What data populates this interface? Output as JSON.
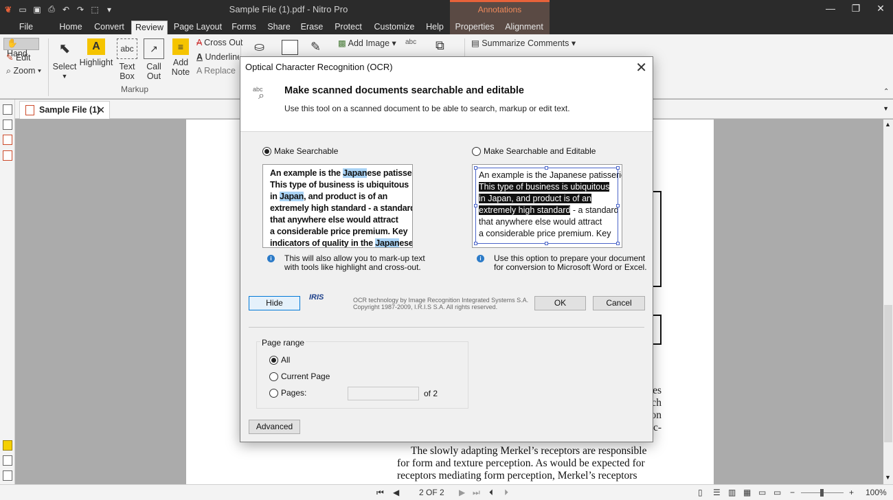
{
  "window": {
    "title": "Sample File (1).pdf - Nitro Pro",
    "context_tab": "Annotations",
    "minimize": "—",
    "restore": "❐",
    "close": "✕"
  },
  "quick_access": [
    "nitro-logo-icon",
    "open-icon",
    "save-icon",
    "print-icon",
    "undo-icon",
    "redo-icon",
    "cursor-icon",
    "customize-icon"
  ],
  "menu": {
    "tabs": [
      "File",
      "Home",
      "Convert",
      "Review",
      "Page Layout",
      "Forms",
      "Share",
      "Erase",
      "Protect",
      "Customize",
      "Help",
      "Properties",
      "Alignment"
    ],
    "active": "Review"
  },
  "ribbon": {
    "hand": "Hand",
    "edit": "Edit",
    "zoom": "Zoom",
    "select": "Select",
    "highlight": "Highlight",
    "text_box_1": "Text",
    "text_box_2": "Box",
    "call_out_1": "Call",
    "call_out_2": "Out",
    "add_note_1": "Add",
    "add_note_2": "Note",
    "cross_out": "Cross Out",
    "underline": "Underline",
    "replace": "Replace",
    "group_label": "Markup",
    "add_image": "Add Image",
    "summarize_comments": "Summarize Comments"
  },
  "document": {
    "tab_label": "Sample File (1)",
    "page_lines": [
      "The slowly adapting Merkel’s receptors are responsible",
      "for form and texture perception. As would be expected for",
      "receptors mediating form perception, Merkel’s receptors"
    ],
    "edge_fragments": [
      "es",
      "ch",
      "on",
      "c-"
    ]
  },
  "statusbar": {
    "page_indicator": "2 OF 2",
    "zoom": "100%"
  },
  "dialog": {
    "title": "Optical Character Recognition (OCR)",
    "header_title": "Make scanned documents searchable and editable",
    "header_subtitle": "Use this tool on a scanned document to be able to search, markup or edit text.",
    "option1": {
      "label": "Make Searchable",
      "selected": true,
      "info_line1": "This will also allow you to mark-up text",
      "info_line2": "with tools like highlight and cross-out."
    },
    "option2": {
      "label": "Make Searchable and Editable",
      "selected": false,
      "info_line1": "Use this option to prepare your document",
      "info_line2": "for conversion to Microsoft Word or Excel."
    },
    "preview_text": {
      "l1_pre": "An example is the ",
      "l1_hl": "Japan",
      "l1_post": "ese patisserie.",
      "l2": "This type of business is ubiquitous",
      "l3_pre": "in ",
      "l3_hl": "Japan",
      "l3_post": ", and product is of an",
      "l4": "extremely high standard - a standard",
      "l5": "that anywhere else would attract",
      "l6": "a considerable price premium. Key",
      "l7_pre": "indicators of quality in the ",
      "l7_hl": "Japan",
      "l7_post": "ese"
    },
    "preview2_text": {
      "l1": "An example is the Japanese patisserie.",
      "l2": "This type of business is ubiquitous",
      "l3": "in Japan, and product is of an",
      "l4_sel": "extremely high standard",
      "l4_post": " - a standard",
      "l5": "that anywhere else would attract",
      "l6": "a considerable price premium. Key"
    },
    "hide_button": "Hide",
    "iris_logo": "IRIS",
    "ocr_credit_line1": "OCR technology by Image Recognition Integrated Systems S.A.",
    "ocr_credit_line2": "Copyright 1987-2009, I.R.I.S S.A. All rights reserved.",
    "ok_button": "OK",
    "cancel_button": "Cancel",
    "page_range": {
      "legend": "Page range",
      "all": "All",
      "current_page": "Current Page",
      "pages": "Pages:",
      "pages_value": "",
      "of_total": "of 2",
      "selected": "All"
    },
    "advanced_button": "Advanced"
  },
  "colors": {
    "titlebar": "#2b2b2b",
    "annotations_accent": "#e8623a",
    "highlight_blue": "#a9d3f5",
    "focus_blue": "#0078d7",
    "info_icon": "#2c7bc8"
  }
}
